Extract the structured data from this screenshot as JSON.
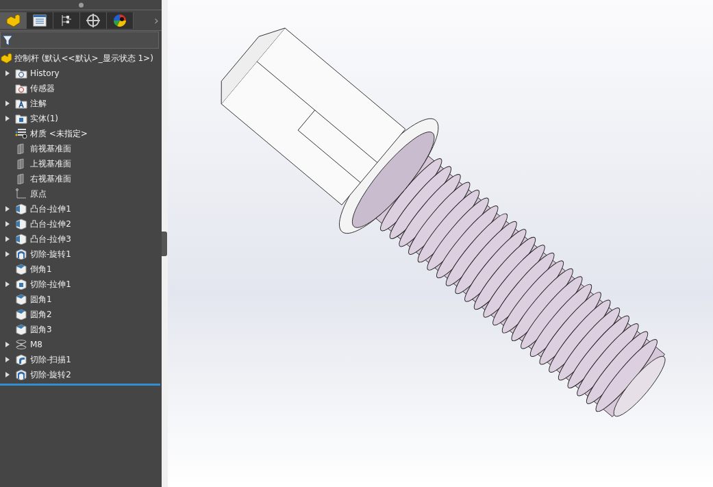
{
  "tabs": [
    {
      "kind": "feature",
      "selected": true
    },
    {
      "kind": "property",
      "selected": false
    },
    {
      "kind": "config",
      "selected": false
    },
    {
      "kind": "dim",
      "selected": false
    },
    {
      "kind": "display",
      "selected": false
    }
  ],
  "tabs_more": "›",
  "tree": {
    "root": "控制杆  (默认<<默认>_显示状态 1>)",
    "items": [
      {
        "label": "History",
        "kind": "history",
        "expandable": true
      },
      {
        "label": "传感器",
        "kind": "sensor",
        "expandable": false
      },
      {
        "label": "注解",
        "kind": "annotation",
        "expandable": true
      },
      {
        "label": "实体(1)",
        "kind": "solid",
        "expandable": true
      },
      {
        "label": "材质 <未指定>",
        "kind": "material",
        "expandable": false
      },
      {
        "label": "前视基准面",
        "kind": "plane",
        "expandable": false
      },
      {
        "label": "上视基准面",
        "kind": "plane",
        "expandable": false
      },
      {
        "label": "右视基准面",
        "kind": "plane",
        "expandable": false
      },
      {
        "label": "原点",
        "kind": "origin",
        "expandable": false
      },
      {
        "label": "凸台-拉伸1",
        "kind": "boss",
        "expandable": true
      },
      {
        "label": "凸台-拉伸2",
        "kind": "boss",
        "expandable": true
      },
      {
        "label": "凸台-拉伸3",
        "kind": "boss",
        "expandable": true
      },
      {
        "label": "切除-旋转1",
        "kind": "revolve",
        "expandable": true
      },
      {
        "label": "倒角1",
        "kind": "chamfer",
        "expandable": false
      },
      {
        "label": "切除-拉伸1",
        "kind": "cut",
        "expandable": true
      },
      {
        "label": "圆角1",
        "kind": "fillet",
        "expandable": false
      },
      {
        "label": "圆角2",
        "kind": "fillet",
        "expandable": false
      },
      {
        "label": "圆角3",
        "kind": "fillet",
        "expandable": false
      },
      {
        "label": "M8",
        "kind": "thread",
        "expandable": true
      },
      {
        "label": "切除-扫描1",
        "kind": "sweep",
        "expandable": true
      },
      {
        "label": "切除-旋转2",
        "kind": "revolve",
        "expandable": true
      }
    ]
  }
}
